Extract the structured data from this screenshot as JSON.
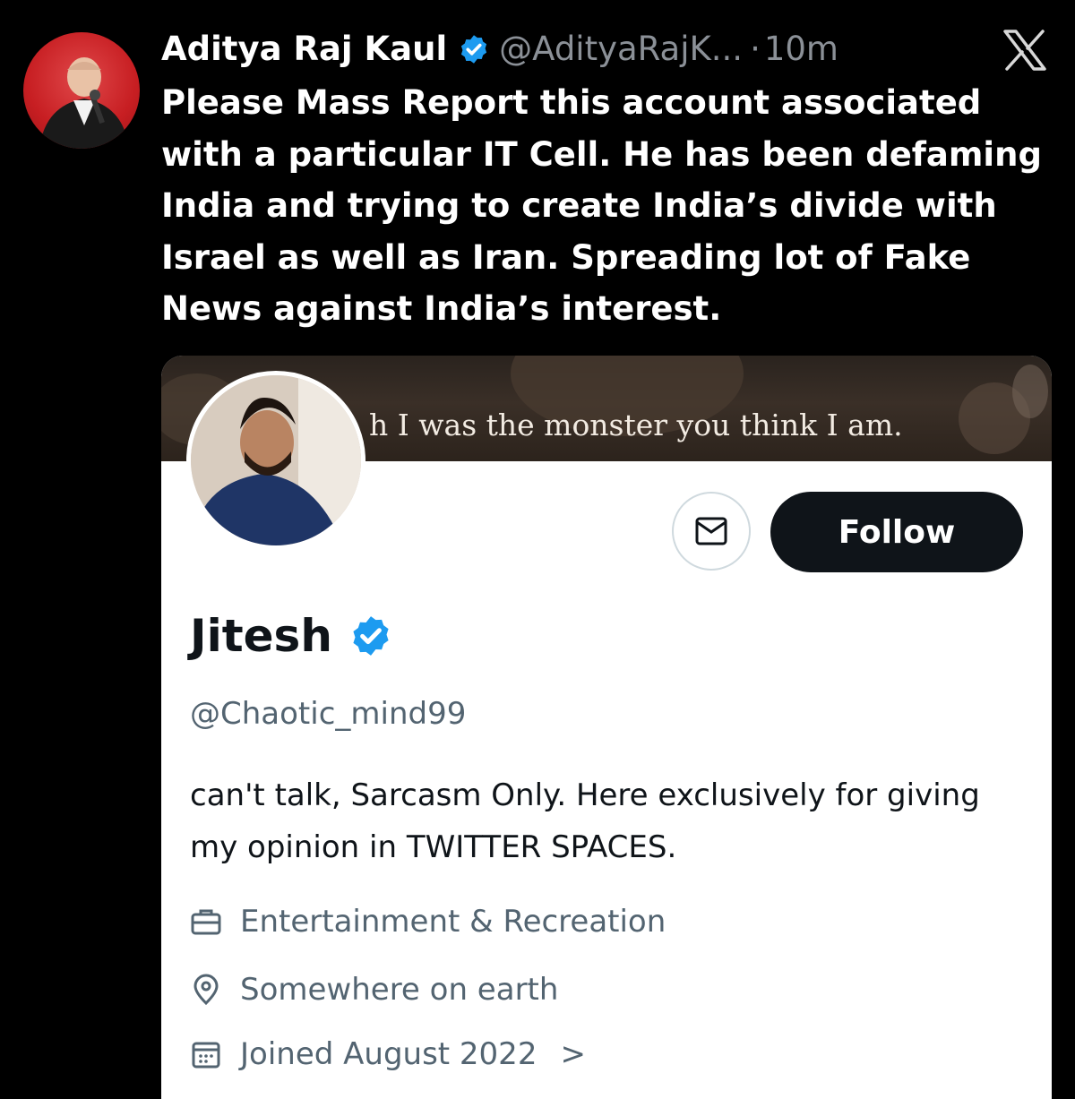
{
  "tweet": {
    "author_name": "Aditya Raj Kaul",
    "author_handle": "@AdityaRajK...",
    "separator": "·",
    "time": "10m",
    "text": "Please Mass Report this account associated with a particular IT Cell. He has been defaming India and trying to create India’s divide with Israel as well as Iran. Spreading lot of Fake News against India’s interest.",
    "verified_icon": "verified-badge-icon",
    "platform_icon": "x-logo-icon"
  },
  "profile_card": {
    "banner_text": "h I was the monster you think I am.",
    "message_icon": "envelope-icon",
    "follow_label": "Follow",
    "display_name": "Jitesh",
    "handle": "@Chaotic_mind99",
    "bio": "can't talk, Sarcasm Only. Here exclusively for giving my opinion in TWITTER SPACES.",
    "category": "Entertainment & Recreation",
    "location": "Somewhere on earth",
    "joined": "Joined August 2022",
    "joined_chevron": ">",
    "icons": [
      "briefcase-icon",
      "location-pin-icon",
      "calendar-icon"
    ]
  },
  "colors": {
    "background": "#000000",
    "verified_blue": "#1d9bf0",
    "muted_text": "#536471",
    "follow_button": "#0f1419"
  }
}
